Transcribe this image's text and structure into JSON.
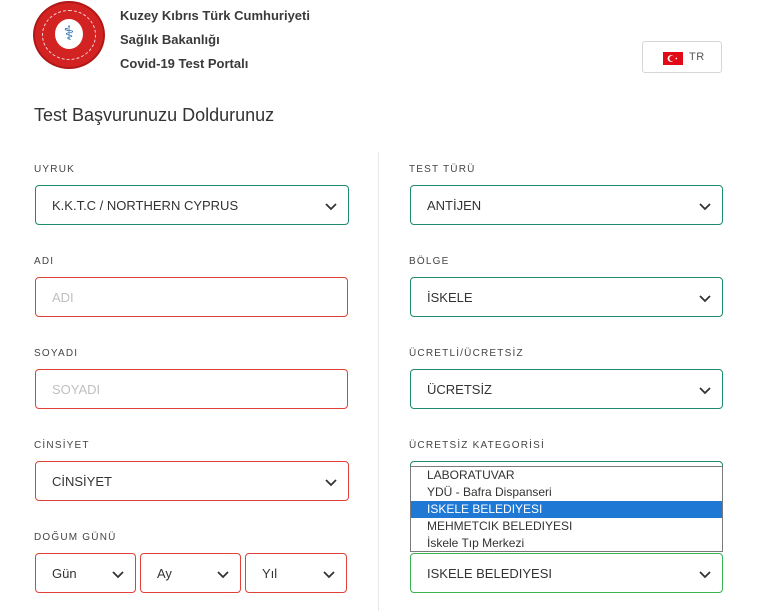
{
  "header": {
    "ministry_line1": "Kuzey Kıbrıs Türk Cumhuriyeti",
    "ministry_line2": "Sağlık Bakanlığı",
    "ministry_line3": "Covid-19 Test Portalı",
    "logo_icon": "ministry-seal-icon",
    "lang_code": "TR",
    "lang_flag_color": "#e30a17"
  },
  "form": {
    "title": "Test Başvurunuzu Doldurunuz",
    "left": {
      "nationality": {
        "label": "UYRUK",
        "value": "K.K.T.C / NORTHERN CYPRUS"
      },
      "first_name": {
        "label": "ADI",
        "placeholder": "ADI"
      },
      "last_name": {
        "label": "SOYADI",
        "placeholder": "SOYADI"
      },
      "gender": {
        "label": "CİNSİYET",
        "value": "CİNSİYET"
      },
      "birth_date": {
        "label": "DOĞUM GÜNÜ",
        "day": "Gün",
        "month": "Ay",
        "year": "Yıl"
      }
    },
    "right": {
      "test_type": {
        "label": "TEST TÜRÜ",
        "value": "ANTİJEN"
      },
      "region": {
        "label": "BÖLGE",
        "value": "İSKELE"
      },
      "paid": {
        "label": "ÜCRETLİ/ÜCRETSİZ",
        "value": "ÜCRETSİZ"
      },
      "free_category": {
        "label": "ÜCRETSİZ KATEGORİSİ",
        "options": [
          "LABORATUVAR",
          "YDÜ - Bafra Dispanseri",
          "ISKELE BELEDIYESI",
          "MEHMETCIK BELEDIYESI",
          "İskele Tıp Merkezi"
        ],
        "highlighted_index": 2
      },
      "bottom_select": {
        "value": "ISKELE BELEDIYESI"
      }
    }
  },
  "colors": {
    "valid_border": "#1e8a6e",
    "error_border": "#e0423a",
    "selected_option": "#1e78d4"
  }
}
